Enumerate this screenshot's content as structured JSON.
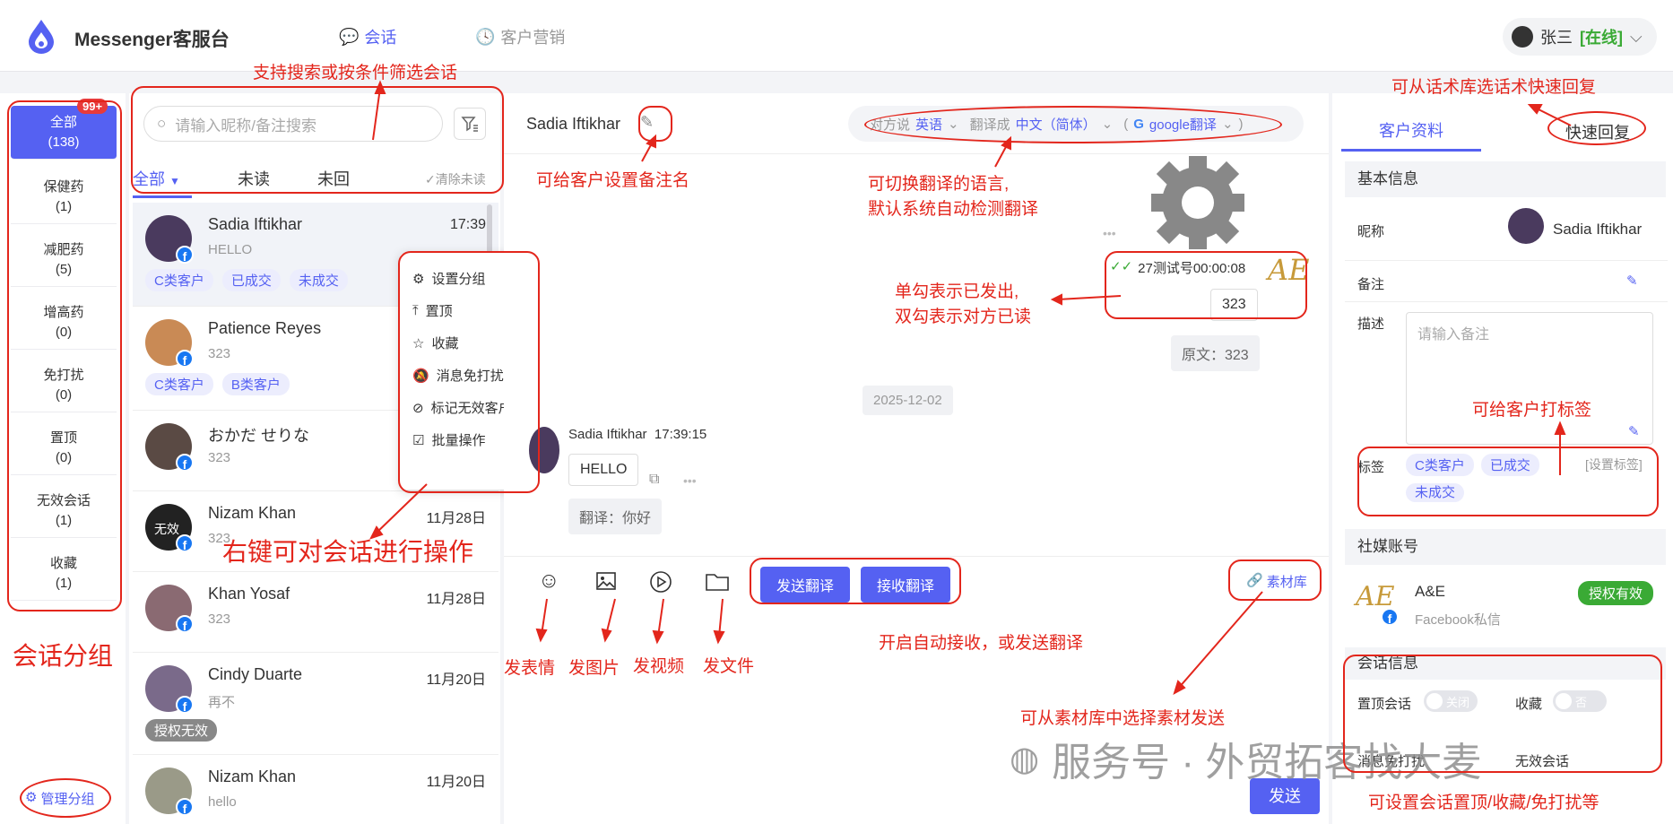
{
  "app": {
    "title": "Messenger客服台"
  },
  "nav": [
    {
      "label": "会话"
    },
    {
      "label": "客户营销"
    }
  ],
  "user": {
    "name": "张三",
    "status": "[在线]"
  },
  "groups": {
    "items": [
      {
        "label": "全部",
        "count": "(138)"
      },
      {
        "label": "保健药",
        "count": "(1)"
      },
      {
        "label": "减肥药",
        "count": "(5)"
      },
      {
        "label": "增高药",
        "count": "(0)"
      },
      {
        "label": "免打扰",
        "count": "(0)"
      },
      {
        "label": "置顶",
        "count": "(0)"
      },
      {
        "label": "无效会话",
        "count": "(1)"
      },
      {
        "label": "收藏",
        "count": "(1)"
      }
    ],
    "badge": "99+",
    "manage": "管理分组"
  },
  "search": {
    "placeholder": "请输入昵称/备注搜索"
  },
  "tabs": {
    "all": "全部",
    "unread": "未读",
    "unreplied": "未回",
    "clear": "清除未读"
  },
  "conversations": [
    {
      "name": "Sadia Iftikhar",
      "time": "17:39",
      "msg": "HELLO",
      "tags": [
        "C类客户",
        "已成交",
        "未成交"
      ],
      "avatar": "#4a3a5e"
    },
    {
      "name": "Patience Reyes",
      "time": "",
      "msg": "323",
      "tags": [
        "C类客户",
        "B类客户"
      ],
      "avatar": "#c98a55"
    },
    {
      "name": "おかだ せりな",
      "time": "",
      "msg": "323",
      "tags": [],
      "avatar": "#5a4a44"
    },
    {
      "name": "Nizam Khan",
      "time": "11月28日",
      "msg": "323",
      "tags": [],
      "avatar": "#222222",
      "avatar_text": "无效"
    },
    {
      "name": "Khan Yosaf",
      "time": "11月28日",
      "msg": "323",
      "tags": [],
      "avatar": "#8a6a72"
    },
    {
      "name": "Cindy Duarte",
      "time": "11月20日",
      "msg": "再不",
      "tags": [
        "授权无效"
      ],
      "avatar": "#7a6a8a"
    },
    {
      "name": "Nizam Khan",
      "time": "11月20日",
      "msg": "hello",
      "tags": [],
      "avatar": "#9a9a88"
    }
  ],
  "context_menu": [
    "设置分组",
    "置顶",
    "收藏",
    "消息免打扰",
    "标记无效客户",
    "批量操作"
  ],
  "chat": {
    "contact": "Sadia Iftikhar",
    "trans_label1": "对方说",
    "trans_lang1": "英语",
    "trans_label2": "翻译成",
    "trans_lang2": "中文（简体）",
    "trans_engine": "google翻译",
    "sent_header": "27测试号00:00:08",
    "sent_msg": "323",
    "sent_orig": "原文：323",
    "date": "2025-12-02",
    "in_name": "Sadia Iftikhar",
    "in_time": "17:39:15",
    "in_msg": "HELLO",
    "in_trans": "翻译：你好",
    "btn_send_trans": "发送翻译",
    "btn_recv_trans": "接收翻译",
    "material": "素材库",
    "send": "发送"
  },
  "right": {
    "tab_profile": "客户资料",
    "tab_quick": "快速回复",
    "basic": "基本信息",
    "nick_label": "昵称",
    "nick": "Sadia Iftikhar",
    "note_label": "备注",
    "desc_label": "描述",
    "desc_placeholder": "请输入备注",
    "tag_label": "标签",
    "tags": [
      "C类客户",
      "已成交",
      "未成交"
    ],
    "set_tag": "[设置标签]",
    "social": "社媒账号",
    "account": "A&E",
    "account_sub": "Facebook私信",
    "auth": "授权有效",
    "conv_info": "会话信息",
    "top_label": "置顶会话",
    "top_val": "关闭",
    "fav_label": "收藏",
    "fav_val": "否",
    "mute_label": "消息免打扰",
    "invalid_label": "无效会话"
  },
  "annotations": {
    "a1": "支持搜索或按条件筛选会话",
    "a2": "可给客户设置备注名",
    "a3": "可切换翻译的语言,",
    "a3b": "默认系统自动检测翻译",
    "a4": "单勾表示已发出,",
    "a4b": "双勾表示对方已读",
    "a5": "右键可对会话进行操作",
    "a6": "会话分组",
    "a7": "发表情",
    "a8": "发图片",
    "a9": "发视频",
    "a10": "发文件",
    "a11": "开启自动接收，或发送翻译",
    "a12": "可从素材库中选择素材发送",
    "a13": "可从话术库选话术快速回复",
    "a14": "可给客户打标签",
    "a15": "可设置会话置顶/收藏/免打扰等",
    "watermark": "服务号 · 外贸拓客找大麦"
  },
  "colors": {
    "accent": "#5561f2",
    "annotation": "#e3261c",
    "online": "#3aaa35"
  }
}
